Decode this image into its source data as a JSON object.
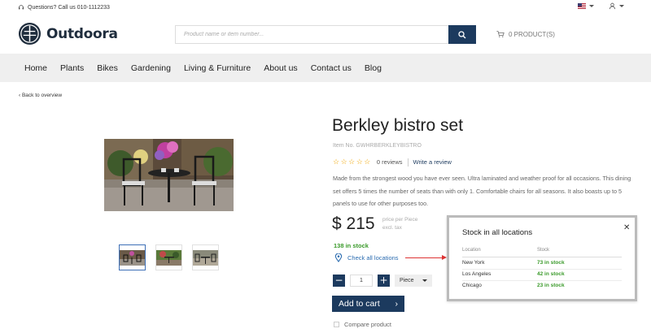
{
  "topbar": {
    "help_text": "Questions? Call us 010-1112233"
  },
  "header": {
    "brand": "Outdoora",
    "search_placeholder": "Product name or item number...",
    "cart_label": "0 PRODUCT(S)"
  },
  "nav": {
    "items": [
      "Home",
      "Plants",
      "Bikes",
      "Gardening",
      "Living & Furniture",
      "About us",
      "Contact us",
      "Blog"
    ]
  },
  "breadcrumb": {
    "back": "‹ Back to overview"
  },
  "product": {
    "title": "Berkley bistro set",
    "item_no": "Item No. GWHRBERKLEYBISTRO",
    "stars": "☆☆☆☆☆",
    "rating_stars": 0,
    "reviews": "0 reviews",
    "write_review": "Write a review",
    "description": "Made from the strongest wood you have ever seen. Ultra laminated and weather proof for all occasions. This dining set offers 5 times the number of seats than with only 1. Comfortable chairs for all seasons. It also boasts up to 5 panels to use for other purposes too.",
    "price": "$ 215",
    "price_per": "price per Piece",
    "price_tax": "excl. tax",
    "stock": "138 in stock",
    "check_locations": "Check all locations",
    "quantity": "1",
    "minus": "−",
    "plus": "+",
    "unit": "Piece",
    "add_to_cart": "Add to cart",
    "add_arrow": "›",
    "compare": "Compare product"
  },
  "popup": {
    "title": "Stock in all locations",
    "close": "✕",
    "col_location": "Location",
    "col_stock": "Stock",
    "rows": [
      {
        "location": "New York",
        "stock": "73 in stock"
      },
      {
        "location": "Los Angeles",
        "stock": "42 in stock"
      },
      {
        "location": "Chicago",
        "stock": "23 in stock"
      }
    ]
  },
  "colors": {
    "brand_navy": "#1c3a5e",
    "stock_green": "#3a9a2a",
    "link_blue": "#2b6cb0",
    "star": "#f0a500"
  }
}
